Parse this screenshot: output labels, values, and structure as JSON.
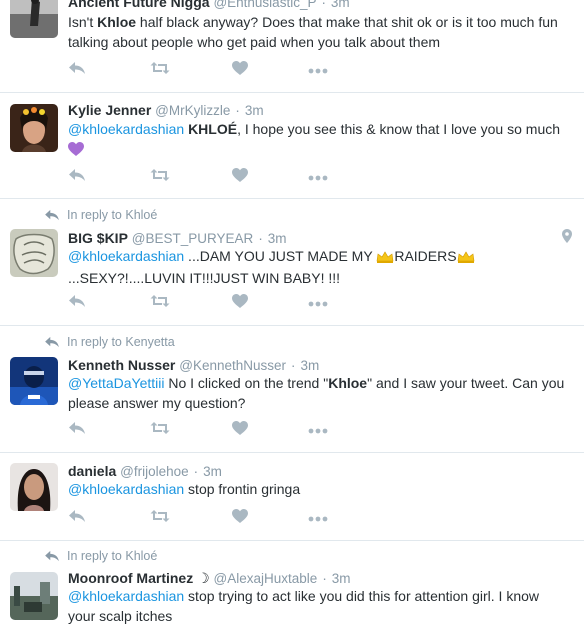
{
  "tweets": [
    {
      "name": "Ancient Future Nigga",
      "handle": "@Enthusiastic_P",
      "time": "3m",
      "text_parts": [
        "Isn't ",
        "Khloe",
        " half black anyway? Does that make that shit ok or is it too much fun talking about people who get paid when you talk about them"
      ]
    },
    {
      "name": "Kylie Jenner",
      "handle": "@MrKylizzle",
      "time": "3m",
      "mention": "@khloekardashian",
      "text_parts": [
        " ",
        "KHLOÉ",
        ", I hope you see this & know that I love you so much "
      ],
      "emoji": "purple-heart"
    },
    {
      "reply_to": "In reply to Khloé",
      "name": "BIG $KIP",
      "handle": "@BEST_PURYEAR",
      "time": "3m",
      "mention": "@khloekardashian",
      "text_parts": [
        " ...DAM YOU JUST MADE MY ",
        "RAIDERS",
        "...SEXY?!....LUVIN IT!!!JUST WIN BABY! !!!"
      ],
      "emoji": "crown"
    },
    {
      "reply_to": "In reply to Kenyetta",
      "name": "Kenneth Nusser",
      "handle": "@KennethNusser",
      "time": "3m",
      "mention": "@YettaDaYettiii",
      "text_parts": [
        " No I clicked on the trend \"",
        "Khloe",
        "\" and I saw your tweet. Can you please answer my question?"
      ]
    },
    {
      "name": "daniela",
      "handle": "@frijolehoe",
      "time": "3m",
      "mention": "@khloekardashian",
      "text_parts": [
        " stop frontin gringa"
      ]
    },
    {
      "reply_to": "In reply to Khloé",
      "name": "Moonroof Martinez ☽",
      "handle": "@AlexajHuxtable",
      "time": "3m",
      "mention": "@khloekardashian",
      "text_parts": [
        " stop trying to act like you did this for attention girl. I know your scalp itches"
      ]
    }
  ],
  "separator": "·",
  "icons": {
    "reply": "reply-icon",
    "retweet": "retweet-icon",
    "like": "heart-icon",
    "more": "more-icon",
    "location": "location-pin-icon"
  },
  "colors": {
    "link": "#1b95e0",
    "muted": "#8899a6",
    "text": "#292f33",
    "divider": "#e1e8ed"
  }
}
